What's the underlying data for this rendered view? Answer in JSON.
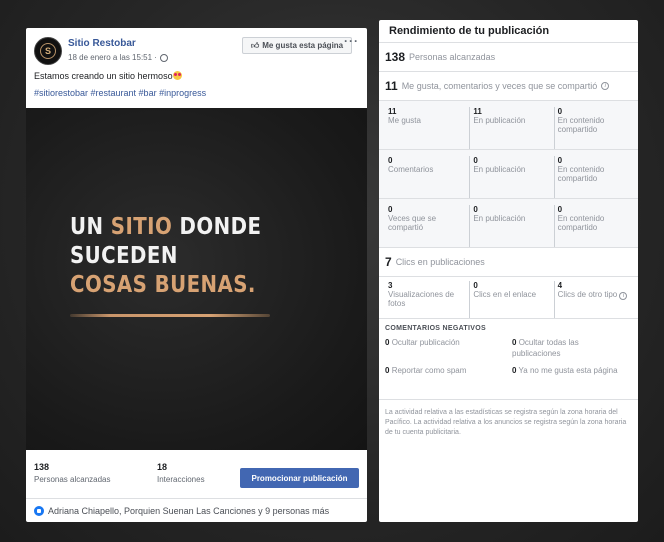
{
  "post": {
    "page_name": "Sitio Restobar",
    "avatar_letter": "S",
    "meta": "18 de enero a las 15:51 · ",
    "like_page_label": "Me gusta esta página",
    "more_label": "···",
    "text": "Estamos creando un sitio hermoso",
    "hashtags": "#sitiorestobar #restaurant #bar #inprogress",
    "image_headline": {
      "line1_a": "UN ",
      "line1_accent": "SITIO",
      "line1_b": " DONDE",
      "line2": "SUCEDEN",
      "line3": "COSAS BUENAS."
    },
    "stats": {
      "reach_num": "138",
      "reach_label": "Personas alcanzadas",
      "interactions_num": "18",
      "interactions_label": "Interacciones"
    },
    "promote_label": "Promocionar publicación",
    "reactions_text": "Adriana Chiapello, Porquien Suenan Las Canciones y 9 personas más"
  },
  "panel": {
    "title": "Rendimiento de tu publicación",
    "reach": {
      "num": "138",
      "label": "Personas alcanzadas"
    },
    "engagement": {
      "num": "11",
      "label": "Me gusta, comentarios y veces que se compartió"
    },
    "rows": [
      [
        {
          "num": "11",
          "label": "Me gusta"
        },
        {
          "num": "11",
          "label": "En publicación"
        },
        {
          "num": "0",
          "label": "En contenido compartido"
        }
      ],
      [
        {
          "num": "0",
          "label": "Comentarios"
        },
        {
          "num": "0",
          "label": "En publicación"
        },
        {
          "num": "0",
          "label": "En contenido compartido"
        }
      ],
      [
        {
          "num": "0",
          "label": "Veces que se compartió"
        },
        {
          "num": "0",
          "label": "En publicación"
        },
        {
          "num": "0",
          "label": "En contenido compartido"
        }
      ]
    ],
    "clicks": {
      "num": "7",
      "label": "Clics en publicaciones"
    },
    "click_row": [
      {
        "num": "3",
        "label": "Visualizaciones de fotos"
      },
      {
        "num": "0",
        "label": "Clics en el enlace"
      },
      {
        "num": "4",
        "label": "Clics de otro tipo"
      }
    ],
    "negative": {
      "title": "COMENTARIOS NEGATIVOS",
      "items": [
        {
          "num": "0",
          "label": "Ocultar publicación"
        },
        {
          "num": "0",
          "label": "Ocultar todas las publicaciones"
        },
        {
          "num": "0",
          "label": "Reportar como spam"
        },
        {
          "num": "0",
          "label": "Ya no me gusta esta página"
        }
      ]
    },
    "footnote": "La actividad relativa a las estadísticas se registra según la zona horaria del Pacífico. La actividad relativa a los anuncios se registra según la zona horaria de tu cuenta publicitaria."
  },
  "colors": {
    "link": "#385898",
    "promote": "#4267b2",
    "accent": "#d7a273"
  },
  "icons": [
    "globe-icon",
    "thumbs-up-icon",
    "more-icon",
    "heart-eyes-emoji-icon",
    "like-reaction-icon",
    "info-icon"
  ]
}
